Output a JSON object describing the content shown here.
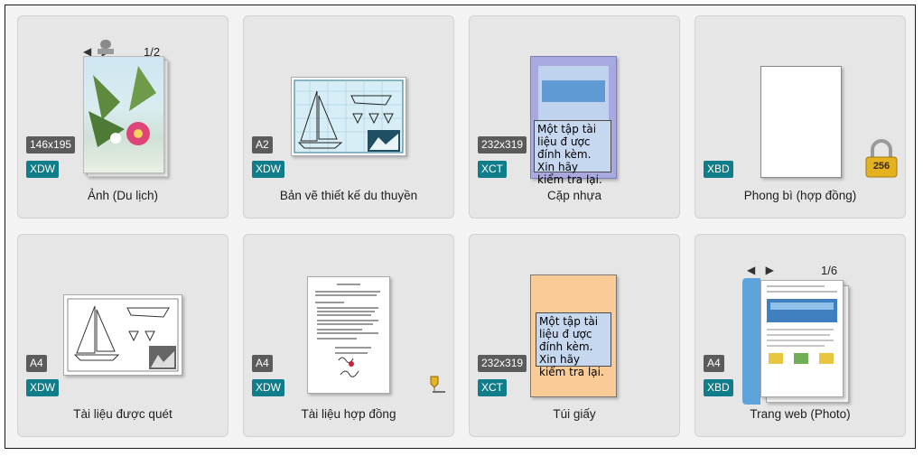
{
  "documents": [
    {
      "name": "Ảnh (Du lịch)",
      "size": "146x195",
      "type": "XDW",
      "page_indicator": "1/2"
    },
    {
      "name": "Bản vẽ thiết kế du thuyền",
      "size": "A2",
      "type": "XDW"
    },
    {
      "name": "Cặp nhựa",
      "size": "232x319",
      "type": "XCT",
      "note": "Một tập tài liệu đ ược đính kèm. Xin hãy kiểm tra lại."
    },
    {
      "name": "Phong bì (hợp đồng)",
      "type": "XBD",
      "lock_label": "256"
    },
    {
      "name": "Tài liệu được quét",
      "size": "A4",
      "type": "XDW"
    },
    {
      "name": "Tài liệu hợp đồng",
      "size": "A4",
      "type": "XDW"
    },
    {
      "name": "Túi giấy",
      "size": "232x319",
      "type": "XCT",
      "note": "Một tập tài liệu đ ược đính kèm. Xin hãy kiểm tra lại."
    },
    {
      "name": "Trang web (Photo)",
      "size": "A4",
      "type": "XBD",
      "page_indicator": "1/6"
    }
  ],
  "colors": {
    "type_badge": "#0f7d8a",
    "size_badge": "#5b5b5b",
    "card_bg": "#e6e6e6"
  }
}
